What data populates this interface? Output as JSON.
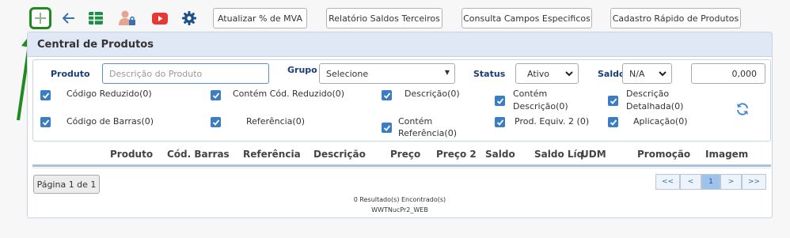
{
  "toolbar": {
    "buttons": [
      "Atualizar % de MVA",
      "Relatório Saldos Terceiros",
      "Consulta Campos Especificos",
      "Cadastro Rápido de Produtos"
    ]
  },
  "panel": {
    "title": "Central de Produtos"
  },
  "filters": {
    "produto_label": "Produto",
    "produto_placeholder": "Descrição do Produto",
    "grupo_label": "Grupo",
    "grupo_value": "Selecione",
    "status_label": "Status",
    "status_value": "Ativo",
    "saldo_label": "Saldo",
    "saldo_value": "N/A",
    "saldo_amount": "0,000"
  },
  "checks": {
    "r1": [
      "Código Reduzido(0)",
      "Contém Cód. Reduzido(0)",
      "Descrição(0)",
      "Contém",
      "Descrição(0)",
      "Descrição",
      "Detalhada(0)"
    ],
    "r2": [
      "Código de Barras(0)",
      "Referência(0)",
      "Contém",
      "Referência(0)",
      "Prod. Equiv. 2 (0)",
      "Aplicação(0)"
    ]
  },
  "table": {
    "columns": [
      "Produto",
      "Cód. Barras",
      "Referência",
      "Descrição",
      "Preço",
      "Preço 2",
      "Saldo",
      "Saldo Líq.",
      "UDM",
      "Promoção",
      "Imagem"
    ]
  },
  "footer": {
    "page_label": "Página 1 de 1",
    "pager": [
      "<<",
      "<",
      "1",
      ">",
      ">>"
    ],
    "results": "0 Resultado(s) Encontrado(s)",
    "source": "WWTNucPr2_WEB"
  },
  "colors": {
    "accent": "#1f8a1f",
    "checkbox": "#3a7dc4",
    "header": "#dfe8f4"
  }
}
